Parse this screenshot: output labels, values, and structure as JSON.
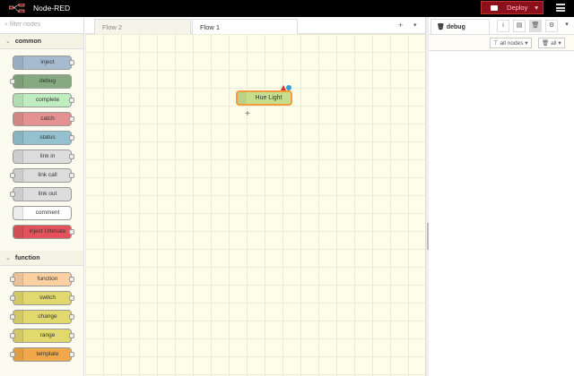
{
  "header": {
    "title": "Node-RED",
    "deploy_label": "Deploy",
    "deploy_caret": "▾"
  },
  "palette": {
    "filter_placeholder": "filter nodes",
    "categories": [
      {
        "label": "common",
        "nodes": [
          {
            "label": "inject",
            "color": "#a6bbcf",
            "in": false,
            "out": true
          },
          {
            "label": "debug",
            "color": "#87a980",
            "in": true,
            "out": false
          },
          {
            "label": "complete",
            "color": "#c0edc0",
            "in": false,
            "out": true
          },
          {
            "label": "catch",
            "color": "#e49191",
            "in": false,
            "out": true
          },
          {
            "label": "status",
            "color": "#94c1d0",
            "in": false,
            "out": true
          },
          {
            "label": "link in",
            "color": "#dddddd",
            "in": false,
            "out": true
          },
          {
            "label": "link call",
            "color": "#dddddd",
            "in": true,
            "out": true
          },
          {
            "label": "link out",
            "color": "#dddddd",
            "in": true,
            "out": false
          },
          {
            "label": "comment",
            "color": "#ffffff",
            "in": false,
            "out": false
          },
          {
            "label": "inject Ultimate",
            "color": "#e2535b",
            "in": false,
            "out": true
          }
        ]
      },
      {
        "label": "function",
        "nodes": [
          {
            "label": "function",
            "color": "#fdd0a2",
            "in": true,
            "out": true
          },
          {
            "label": "switch",
            "color": "#e2d96e",
            "in": true,
            "out": true
          },
          {
            "label": "change",
            "color": "#e2d96e",
            "in": true,
            "out": true
          },
          {
            "label": "range",
            "color": "#e2d96e",
            "in": true,
            "out": true
          },
          {
            "label": "template",
            "color": "#f0a94a",
            "in": true,
            "out": true
          }
        ]
      }
    ]
  },
  "workspace": {
    "tabs": [
      {
        "label": "Flow 2"
      },
      {
        "label": "Flow 1"
      }
    ],
    "add": "+",
    "menu": "▾",
    "node": {
      "label": "Hue Light"
    },
    "cursor": "+"
  },
  "sidebar": {
    "tab": "debug",
    "tab_icon": "🗑",
    "buttons": [
      "i",
      "▤",
      "🗑",
      "⚙",
      "▾"
    ],
    "filter": "all nodes",
    "clear": "all"
  }
}
